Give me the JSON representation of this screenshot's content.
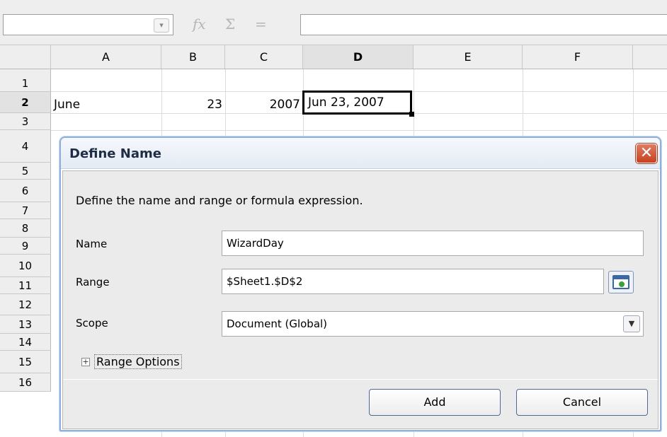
{
  "formula_bar": {
    "name_box_value": "",
    "icons": [
      "function-wizard-icon",
      "sum-icon",
      "formula-icon"
    ],
    "function_glyph": "𝑓x",
    "sum_glyph": "Σ",
    "equals_glyph": "=",
    "formula_value": ""
  },
  "sheet": {
    "columns": [
      "A",
      "B",
      "C",
      "D",
      "E",
      "F"
    ],
    "rows": [
      "1",
      "2",
      "3",
      "4",
      "5",
      "6",
      "7",
      "8",
      "9",
      "10",
      "11",
      "12",
      "13",
      "14",
      "15",
      "16"
    ],
    "cells": {
      "A2": "June",
      "B2": "23",
      "C2": "2007",
      "D2": "Jun 23, 2007"
    },
    "active_cell": "D2",
    "active_row": "2",
    "active_column": "D"
  },
  "dialog": {
    "title": "Define Name",
    "close_glyph": "✕",
    "description": "Define the name and range or formula expression.",
    "name_label": "Name",
    "name_value": "WizardDay",
    "range_label": "Range",
    "range_value": "$Sheet1.$D$2",
    "scope_label": "Scope",
    "scope_value": "Document (Global)",
    "range_options_label": "Range Options",
    "expander_glyph": "+",
    "add_label": "Add",
    "cancel_label": "Cancel"
  }
}
